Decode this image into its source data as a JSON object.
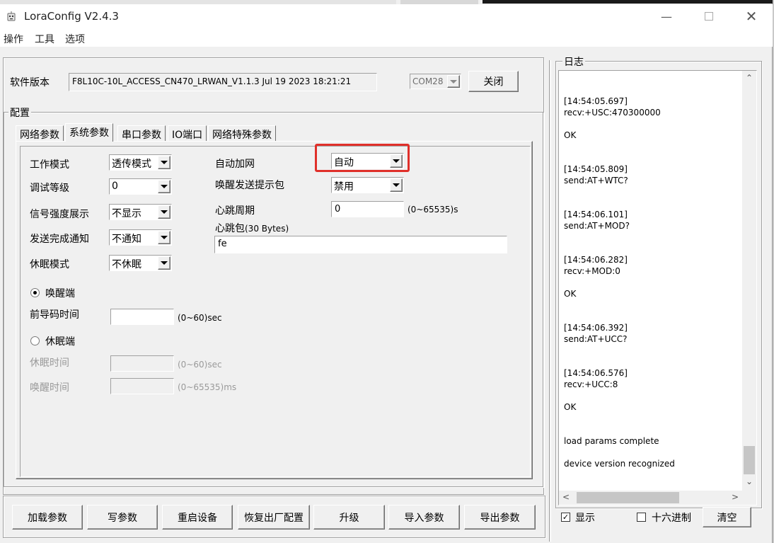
{
  "window": {
    "title": "LoraConfig V2.4.3"
  },
  "menu": [
    "操作",
    "工具",
    "选项"
  ],
  "software_version": {
    "label": "软件版本",
    "value": "F8L10C-10L_ACCESS_CN470_LRWAN_V1.1.3 Jul 19 2023 18:21:21",
    "port": "COM28",
    "close_button": "关闭"
  },
  "config": {
    "group_title": "配置",
    "tabs": [
      "网络参数",
      "系统参数",
      "串口参数",
      "IO端口",
      "网络特殊参数"
    ],
    "active_tab": "系统参数",
    "work_mode": {
      "label": "工作模式",
      "value": "透传模式"
    },
    "debug_level": {
      "label": "调试等级",
      "value": "0"
    },
    "signal_display": {
      "label": "信号强度展示",
      "value": "不显示"
    },
    "send_notify": {
      "label": "发送完成通知",
      "value": "不通知"
    },
    "sleep_mode": {
      "label": "休眠模式",
      "value": "不休眠"
    },
    "auto_join": {
      "label": "自动加网",
      "value": "自动"
    },
    "wake_prompt": {
      "label": "唤醒发送提示包",
      "value": "禁用"
    },
    "heartbeat_period": {
      "label": "心跳周期",
      "value": "0",
      "range": "(0~65535)s"
    },
    "heartbeat_packet": {
      "label": "心跳包",
      "sub": "(30 Bytes)",
      "value": "fe"
    },
    "wake_end": {
      "label": "唤醒端",
      "selected": true
    },
    "preamble_time": {
      "label": "前导码时间",
      "value": "",
      "range": "(0~60)sec"
    },
    "sleep_end": {
      "label": "休眠端",
      "selected": false
    },
    "sleep_time": {
      "label": "休眠时间",
      "value": "",
      "range": "(0~60)sec"
    },
    "wake_time": {
      "label": "唤醒时间",
      "value": "",
      "range": "(0~65535)ms"
    }
  },
  "actions": [
    "加载参数",
    "写参数",
    "重启设备",
    "恢复出厂配置",
    "升级",
    "导入参数",
    "导出参数"
  ],
  "log": {
    "title": "日志",
    "entries": [
      "[14:54:05.697]\nrecv:+USC:470300000\n\nOK\n\n",
      "[14:54:05.809]\nsend:AT+WTC?\n\n",
      "[14:54:06.101]\nsend:AT+MOD?\n\n",
      "[14:54:06.282]\nrecv:+MOD:0\n\nOK\n\n",
      "[14:54:06.392]\nsend:AT+UCC?\n\n",
      "[14:54:06.576]\nrecv:+UCC:8\n\nOK\n\n",
      "load params complete\n",
      "device version recognized"
    ],
    "show_label": "显示",
    "show_checked": true,
    "hex_label": "十六进制",
    "hex_checked": false,
    "clear_button": "清空"
  }
}
